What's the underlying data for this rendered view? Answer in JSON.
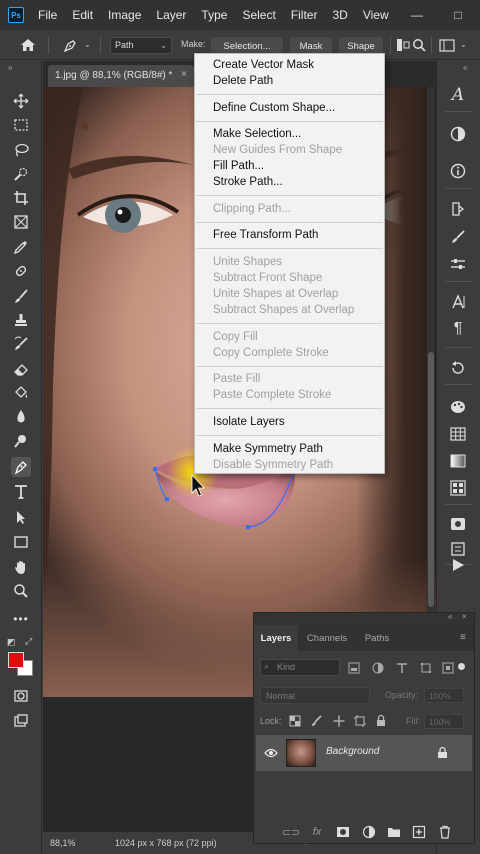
{
  "menubar": {
    "logo": "Ps",
    "items": [
      "File",
      "Edit",
      "Image",
      "Layer",
      "Type",
      "Select",
      "Filter",
      "3D",
      "View"
    ],
    "minimize": "—",
    "maximize": "□"
  },
  "options": {
    "mode": "Path",
    "make_label": "Make:",
    "selection_btn": "Selection...",
    "mask_btn": "Mask",
    "shape_btn": "Shape"
  },
  "document": {
    "tab_title": "1.jpg @ 88,1% (RGB/8#) *",
    "close": "×"
  },
  "status": {
    "zoom": "88,1%",
    "dimensions": "1024 px x 768 px (72 ppi)",
    "arrow": "›"
  },
  "context_menu": {
    "groups": [
      [
        {
          "label": "Create Vector Mask",
          "enabled": true
        },
        {
          "label": "Delete Path",
          "enabled": true
        }
      ],
      [
        {
          "label": "Define Custom Shape...",
          "enabled": true
        }
      ],
      [
        {
          "label": "Make Selection...",
          "enabled": true
        },
        {
          "label": "New Guides From Shape",
          "enabled": false
        },
        {
          "label": "Fill Path...",
          "enabled": true
        },
        {
          "label": "Stroke Path...",
          "enabled": true
        }
      ],
      [
        {
          "label": "Clipping Path...",
          "enabled": false
        }
      ],
      [
        {
          "label": "Free Transform Path",
          "enabled": true
        }
      ],
      [
        {
          "label": "Unite Shapes",
          "enabled": false
        },
        {
          "label": "Subtract Front Shape",
          "enabled": false
        },
        {
          "label": "Unite Shapes at Overlap",
          "enabled": false
        },
        {
          "label": "Subtract Shapes at Overlap",
          "enabled": false
        }
      ],
      [
        {
          "label": "Copy Fill",
          "enabled": false
        },
        {
          "label": "Copy Complete Stroke",
          "enabled": false
        }
      ],
      [
        {
          "label": "Paste Fill",
          "enabled": false
        },
        {
          "label": "Paste Complete Stroke",
          "enabled": false
        }
      ],
      [
        {
          "label": "Isolate Layers",
          "enabled": true
        }
      ],
      [
        {
          "label": "Make Symmetry Path",
          "enabled": true
        },
        {
          "label": "Disable Symmetry Path",
          "enabled": false
        }
      ]
    ]
  },
  "layers_panel": {
    "tabs": [
      "Layers",
      "Channels",
      "Paths"
    ],
    "active_tab": "Layers",
    "kind_placeholder": "Kind",
    "blend_mode": "Normal",
    "opacity_label": "Opacity:",
    "opacity_value": "100%",
    "lock_label": "Lock:",
    "fill_label": "Fill:",
    "fill_value": "100%",
    "layers": [
      {
        "name": "Background",
        "visible": true,
        "locked": true
      }
    ],
    "bottom_icons": [
      "link-icon",
      "fx-icon",
      "mask-icon",
      "adjustment-icon",
      "group-icon",
      "new-layer-icon",
      "trash-icon"
    ]
  },
  "colors": {
    "foreground": "#e00d0d",
    "background": "#ffffff",
    "accent": "#31a8ff"
  }
}
